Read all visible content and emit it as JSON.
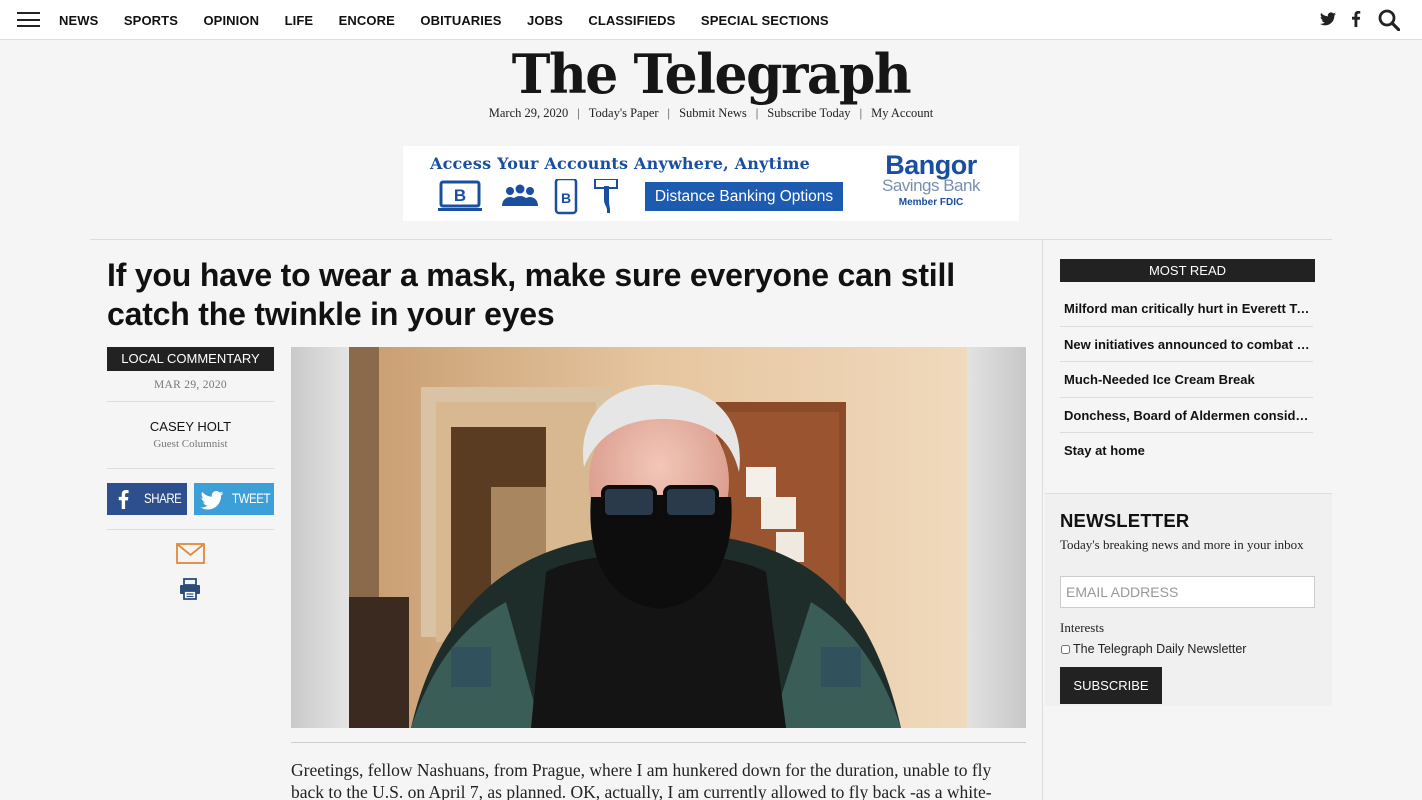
{
  "nav": {
    "items": [
      "NEWS",
      "SPORTS",
      "OPINION",
      "LIFE",
      "ENCORE",
      "OBITUARIES",
      "JOBS",
      "CLASSIFIEDS",
      "SPECIAL SECTIONS"
    ]
  },
  "masthead": {
    "logo": "The Telegraph",
    "date": "March 29, 2020",
    "links": [
      "Today's Paper",
      "Submit News",
      "Subscribe Today",
      "My Account"
    ]
  },
  "ad": {
    "headline": "Access Your Accounts Anywhere, Anytime",
    "cta": "Distance Banking Options",
    "brand_line1": "Bangor",
    "brand_line2": "Savings Bank",
    "brand_line3": "Member FDIC",
    "brand_color": "#1a4fa0"
  },
  "article": {
    "headline": "If you have to wear a mask, make sure everyone can still catch the twinkle in your eyes",
    "section": "LOCAL COMMENTARY",
    "date": "MAR 29, 2020",
    "author": "CASEY HOLT",
    "author_role": "Guest Columnist",
    "share_label": "SHARE",
    "tweet_label": "TWEET",
    "body": "Greetings, fellow Nashuans, from Prague, where I am hunkered down for the duration, unable to fly back to the U.S. on April 7, as planned. OK, actually, I am currently allowed to fly back -as a white-"
  },
  "sidebar": {
    "most_read_title": "MOST READ",
    "most_read": [
      "Milford man critically hurt in Everett Turnpike crash",
      "New initiatives announced to combat spread of virus",
      "Much-Needed Ice Cream Break",
      "Donchess, Board of Aldermen consider changes",
      "Stay at home"
    ],
    "newsletter": {
      "title": "NEWSLETTER",
      "description": "Today's breaking news and more in your inbox",
      "email_placeholder": "EMAIL ADDRESS",
      "interests_label": "Interests",
      "option": "The Telegraph Daily Newsletter",
      "subscribe_label": "SUBSCRIBE"
    }
  },
  "colors": {
    "facebook": "#2d4f8e",
    "twitter": "#3d9fd8",
    "dark": "#222222"
  }
}
